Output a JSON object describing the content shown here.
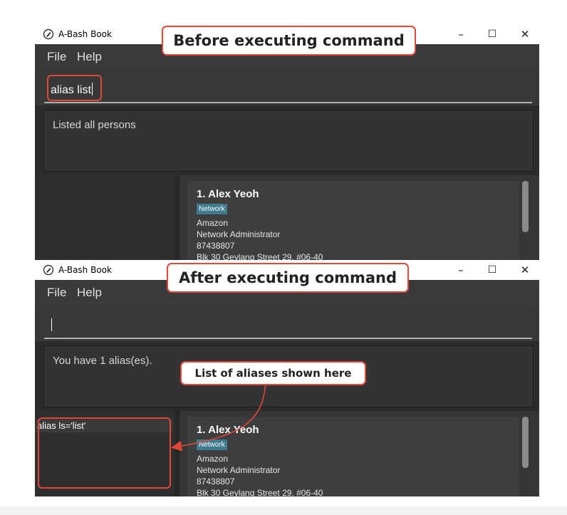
{
  "colors": {
    "window_bg": "#2b2b2b",
    "menubar_bg": "#3a3a3a",
    "tag_bg": "#3e7b91",
    "callout_border": "#e2473a"
  },
  "callouts": {
    "before": "Before executing command",
    "after": "After executing command",
    "aliases": "List of aliases shown here"
  },
  "before_window": {
    "title": "A-Bash Book",
    "controls": {
      "minimize": "–",
      "maximize": "☐",
      "close": "✕"
    },
    "menu": {
      "file": "File",
      "help": "Help"
    },
    "command_value": "alias list",
    "result": "Listed all persons",
    "alias_list": [],
    "person": {
      "name": "1.  Alex Yeoh",
      "tag": "Network",
      "company": "Amazon",
      "role": "Network Administrator",
      "phone": "87438807",
      "address": "Blk 30 Geylang Street 29, #06-40"
    }
  },
  "after_window": {
    "title": "A-Bash Book",
    "controls": {
      "minimize": "–",
      "maximize": "☐",
      "close": "✕"
    },
    "menu": {
      "file": "File",
      "help": "Help"
    },
    "command_value": "",
    "result": "You have 1 alias(es).",
    "alias_list": [
      "alias ls='list'"
    ],
    "person": {
      "name": "1.  Alex Yeoh",
      "tag": "Network",
      "company": "Amazon",
      "role": "Network Administrator",
      "phone": "87438807",
      "address": "Blk 30 Geylang Street 29, #06-40"
    }
  }
}
